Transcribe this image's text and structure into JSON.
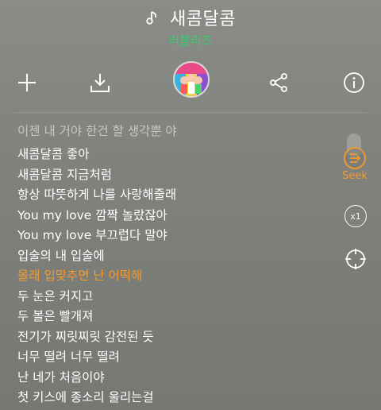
{
  "header": {
    "title": "새콤달콤",
    "artist": "러블리즈"
  },
  "toolbar": {
    "add_icon": "plus-icon",
    "download_icon": "download-icon",
    "album_art": "album-cover",
    "share_icon": "share-icon",
    "info_icon": "info-icon"
  },
  "lyrics": {
    "lines": [
      "이젠 내 거야 한건 할 생각뿐 야",
      "새콤달콤 좋아",
      "새콤달콤 지금처럼",
      "항상 따뜻하게 나를 사랑해줄래",
      "You my love 깜짝 놀랐잖아",
      "You my love 부끄럽다 말야",
      "입술의 내 입술에",
      "몰래 입맞추면 난 어떡해",
      "두 눈은 커지고",
      "두 볼은 빨개져",
      "전기가 찌릿찌릿 감전된 듯",
      "너무 떨려 너무 떨려",
      "난 네가 처음이야",
      "첫 키스에 종소리 울리는걸"
    ],
    "active_index": 7,
    "active_color": "#f49a2a"
  },
  "side": {
    "seek_label": "Seek",
    "speed_label": "x1",
    "accent": "#f49a2a"
  }
}
